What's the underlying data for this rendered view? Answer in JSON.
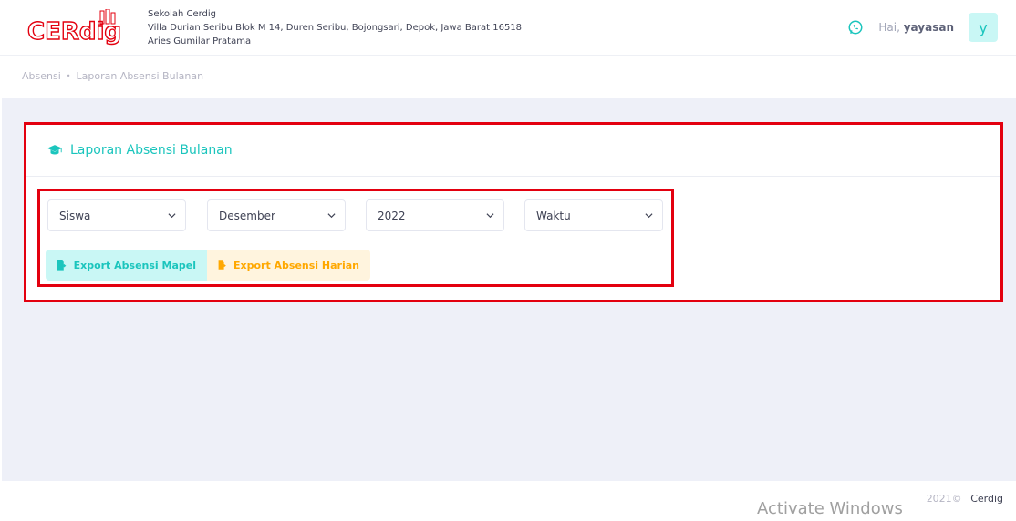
{
  "brand": {
    "logo_text": "CERdig"
  },
  "school": {
    "name": "Sekolah Cerdig",
    "address": "Villa Durian Seribu Blok M 14, Duren Seribu, Bojongsari, Depok, Jawa Barat 16518",
    "principal": "Aries Gumilar Pratama"
  },
  "user": {
    "greeting": "Hai,",
    "name": "yayasan",
    "initial": "y"
  },
  "breadcrumb": {
    "items": [
      "Absensi",
      "Laporan Absensi Bulanan"
    ],
    "separator": "•"
  },
  "card": {
    "title": "Laporan Absensi Bulanan"
  },
  "filters": {
    "type": "Siswa",
    "month": "Desember",
    "year": "2022",
    "time": "Waktu"
  },
  "buttons": {
    "export_mapel": "Export Absensi Mapel",
    "export_harian": "Export Absensi Harian"
  },
  "footer": {
    "year": "2021©",
    "brand": "Cerdig"
  },
  "watermark": "Activate Windows",
  "icons": {
    "whatsapp": "whatsapp-icon",
    "graduation": "graduation-cap-icon",
    "export": "file-export-icon",
    "chevron": "chevron-down-icon"
  },
  "colors": {
    "primary": "#1bc5bd",
    "primary_light": "#c9f7f5",
    "warning": "#ffa800",
    "warning_light": "#fff4de",
    "highlight": "#e3000f",
    "logo_red": "#e3000f"
  }
}
